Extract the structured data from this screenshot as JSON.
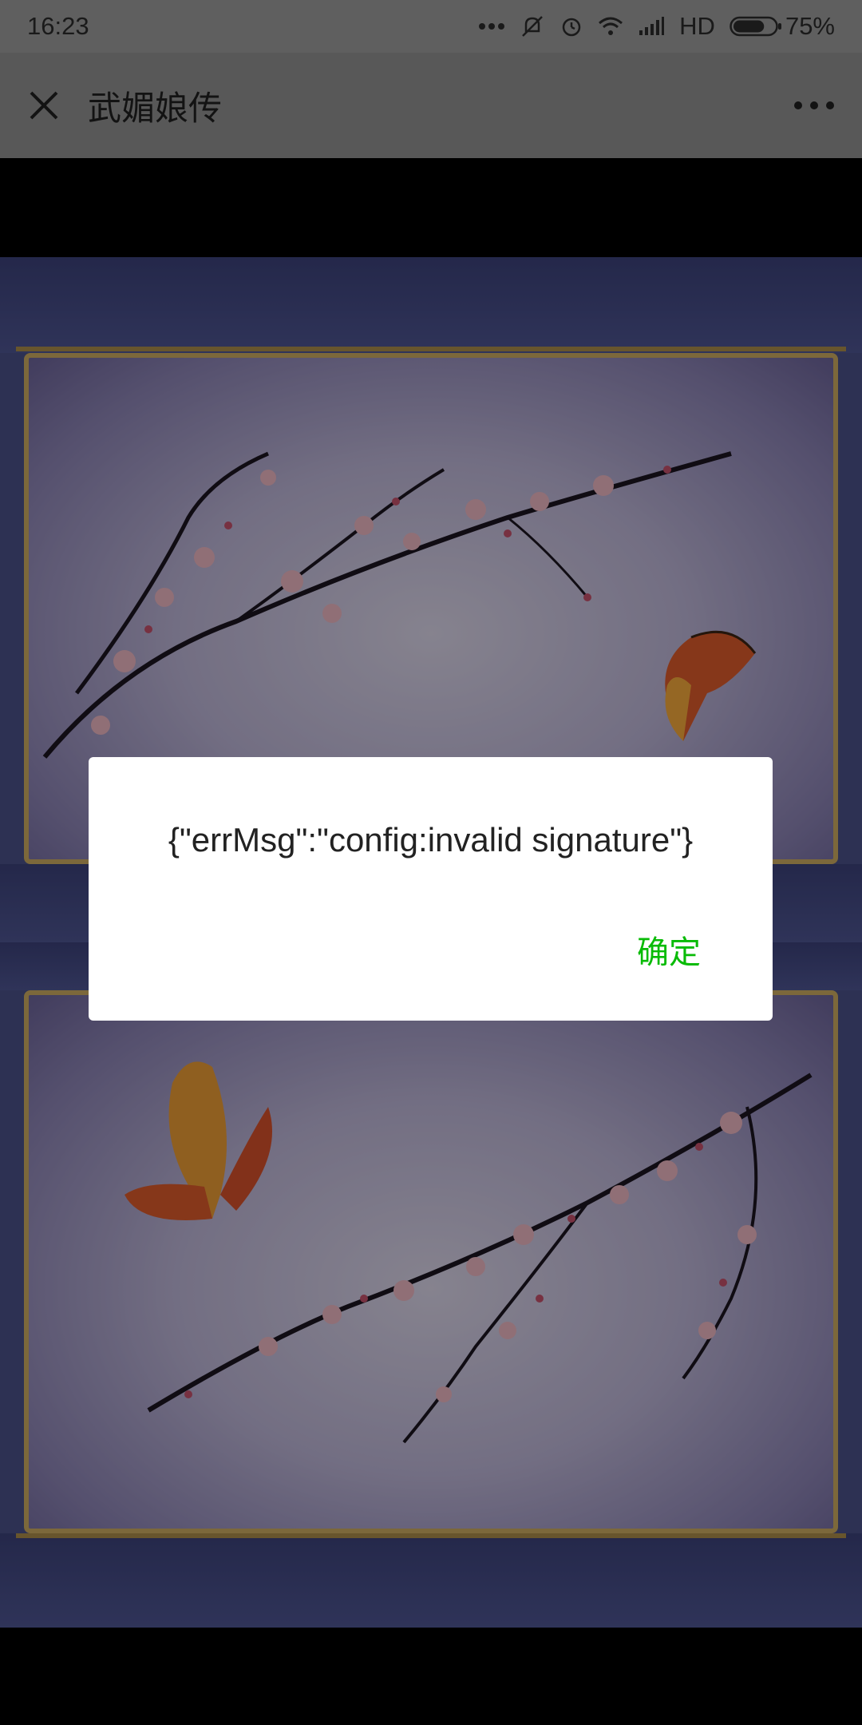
{
  "status_bar": {
    "time": "16:23",
    "network_type": "HD",
    "battery_percent": "75%",
    "battery_level": 0.75,
    "icons": [
      "more-dots-icon",
      "vibrate-off-icon",
      "alarm-icon",
      "wifi-icon",
      "signal-icon",
      "battery-icon"
    ]
  },
  "title_bar": {
    "title": "武媚娘传",
    "close_icon": "close-icon",
    "more_icon": "more-horizontal-icon"
  },
  "dialog": {
    "message": "{\"errMsg\":\"config:invalid signature\"}",
    "ok_label": "确定"
  },
  "colors": {
    "accent_green": "#09bb07",
    "status_bar_bg": "#999999",
    "title_bar_bg": "#8f8f8f"
  }
}
